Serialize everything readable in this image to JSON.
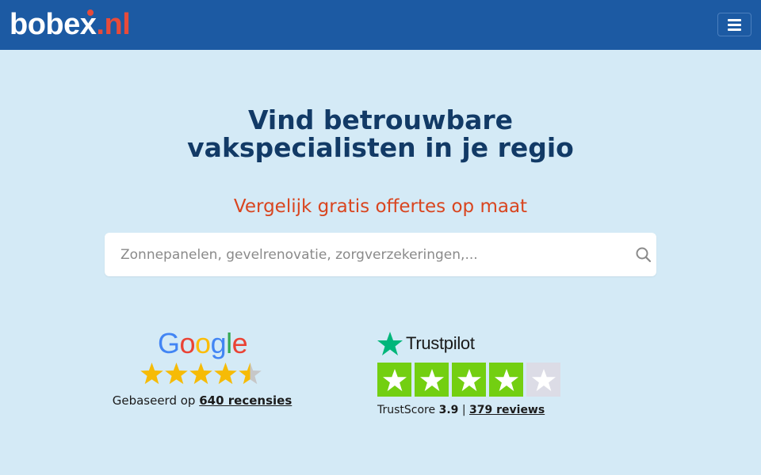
{
  "header": {
    "logo": {
      "main": "bobe",
      "x": "x",
      "tld": ".nl"
    },
    "menu_icon": "hamburger-menu-icon"
  },
  "hero": {
    "title_line1": "Vind betrouwbare",
    "title_line2": "vakspecialisten in je regio",
    "subtitle": "Vergelijk gratis offertes op maat"
  },
  "search": {
    "placeholder": "Zonnepanelen, gevelrenovatie, zorgverzekeringen,...",
    "value": "",
    "icon": "search-icon"
  },
  "google": {
    "logo_text": "Google",
    "rating": 4.5,
    "stars_max": 5,
    "caption_prefix": "Gebaseerd op",
    "caption_link": "640 recensies"
  },
  "trustpilot": {
    "logo_text": "Trustpilot",
    "stars_filled": 4,
    "stars_max": 5,
    "score_label": "TrustScore",
    "score": "3.9",
    "separator": "|",
    "reviews_link": "379 reviews"
  },
  "colors": {
    "header_bg": "#1c5aa3",
    "page_bg": "#d4eaf6",
    "title": "#123a66",
    "subtitle": "#d9451f",
    "accent_red": "#e84b3a",
    "trustpilot_green": "#73cf11",
    "google_star": "#f6bb06"
  }
}
